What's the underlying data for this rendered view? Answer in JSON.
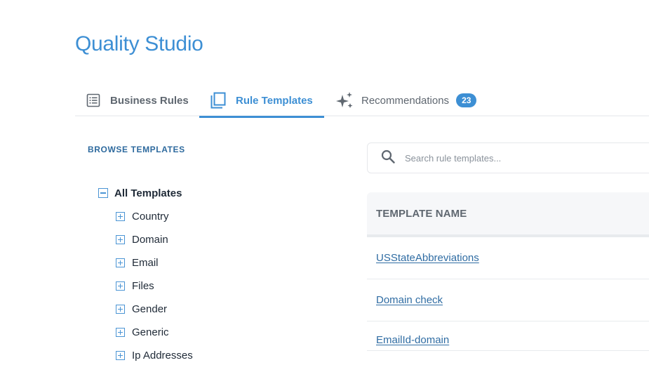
{
  "app": {
    "title": "Quality Studio"
  },
  "tabs": [
    {
      "label": "Business Rules",
      "icon": "list-icon",
      "active": false
    },
    {
      "label": "Rule Templates",
      "icon": "copy-icon",
      "active": true
    },
    {
      "label": "Recommendations",
      "icon": "sparkles-icon",
      "active": false,
      "badge": "23"
    }
  ],
  "browse": {
    "heading": "BROWSE TEMPLATES",
    "root": {
      "label": "All Templates",
      "expanded": true
    },
    "items": [
      {
        "label": "Country"
      },
      {
        "label": "Domain"
      },
      {
        "label": "Email"
      },
      {
        "label": "Files"
      },
      {
        "label": "Gender"
      },
      {
        "label": "Generic"
      },
      {
        "label": "Ip Addresses"
      }
    ]
  },
  "search": {
    "placeholder": "Search rule templates...",
    "value": ""
  },
  "table": {
    "columns": [
      "TEMPLATE NAME"
    ],
    "rows": [
      {
        "name": "USStateAbbreviations"
      },
      {
        "name": "Domain check"
      },
      {
        "name": "EmailId-domain"
      }
    ]
  },
  "colors": {
    "accent": "#3d8fd4",
    "link": "#2f6ca3",
    "heading": "#2e6a9e"
  }
}
